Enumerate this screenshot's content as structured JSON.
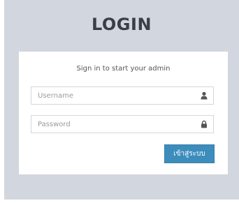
{
  "logo": {
    "title": "LOGIN"
  },
  "login_box": {
    "message": "Sign in to start your admin",
    "username_field": {
      "placeholder": "Username",
      "value": "",
      "icon": "user-icon"
    },
    "password_field": {
      "placeholder": "Password",
      "value": "",
      "icon": "lock-icon"
    },
    "submit_label": "เข้าสู่ระบบ"
  },
  "colors": {
    "page_background": "#d2d6de",
    "box_background": "#ffffff",
    "button_background": "#3c8dbc",
    "button_text": "#ffffff",
    "title_text": "#3a3f45",
    "icon_color": "#555555"
  }
}
